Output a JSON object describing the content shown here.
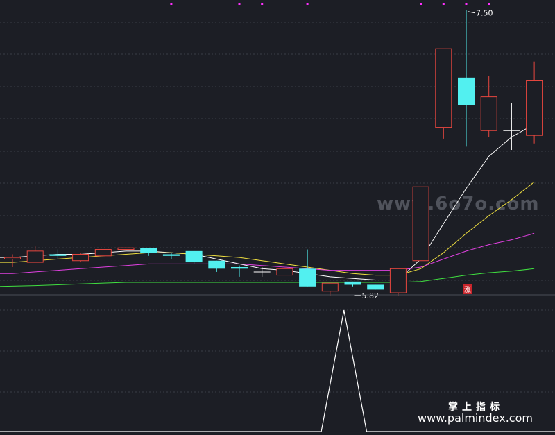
{
  "colors": {
    "background": "#1c1e25",
    "grid": "#3a3d46",
    "up": "#e8473f",
    "down": "#52f0f0",
    "neutral": "#ffffff",
    "ma_short": "#ffffff",
    "ma_mid": "#f0e040",
    "ma_long": "#e040e0",
    "ma_longest": "#40e040",
    "indicator_line": "#ffffff",
    "markers": "#ff30ff",
    "flag_bg": "#c8242a"
  },
  "annotations": {
    "high_label": "7.50",
    "low_label": "5.82",
    "flag_label": "涨"
  },
  "watermark": "www.6o7o.com",
  "brand": {
    "name_cn": "掌上指标",
    "url": "www.palmindex.com"
  },
  "chart_data": [
    {
      "type": "candlestick",
      "title": "",
      "ylim": [
        5.7,
        7.55
      ],
      "price_per_px": 0.00432,
      "top_price": 7.55,
      "candles": [
        {
          "o": 5.98,
          "c": 5.99,
          "h": 6.01,
          "l": 5.93
        },
        {
          "o": 5.96,
          "c": 6.03,
          "h": 6.06,
          "l": 5.96
        },
        {
          "o": 6.01,
          "c": 6.0,
          "h": 6.04,
          "l": 5.98
        },
        {
          "o": 5.97,
          "c": 6.01,
          "h": 6.02,
          "l": 5.96
        },
        {
          "o": 6.0,
          "c": 6.04,
          "h": 6.04,
          "l": 6.0
        },
        {
          "o": 6.04,
          "c": 6.05,
          "h": 6.06,
          "l": 6.03
        },
        {
          "o": 6.05,
          "c": 6.02,
          "h": 6.05,
          "l": 6.0
        },
        {
          "o": 6.01,
          "c": 6.0,
          "h": 6.02,
          "l": 5.98
        },
        {
          "o": 6.03,
          "c": 5.96,
          "h": 6.03,
          "l": 5.95
        },
        {
          "o": 5.97,
          "c": 5.92,
          "h": 5.97,
          "l": 5.9
        },
        {
          "o": 5.93,
          "c": 5.92,
          "h": 5.94,
          "l": 5.87
        },
        {
          "o": 5.9,
          "c": 5.9,
          "h": 5.93,
          "l": 5.87
        },
        {
          "o": 5.88,
          "c": 5.92,
          "h": 5.92,
          "l": 5.88
        },
        {
          "o": 5.92,
          "c": 5.81,
          "h": 6.04,
          "l": 5.81
        },
        {
          "o": 5.78,
          "c": 5.83,
          "h": 5.83,
          "l": 5.75
        },
        {
          "o": 5.84,
          "c": 5.82,
          "h": 5.84,
          "l": 5.81
        },
        {
          "o": 5.82,
          "c": 5.79,
          "h": 5.82,
          "l": 5.79
        },
        {
          "o": 5.77,
          "c": 5.92,
          "h": 5.92,
          "l": 5.75
        },
        {
          "o": 5.97,
          "c": 6.43,
          "h": 6.43,
          "l": 5.97
        },
        {
          "o": 6.8,
          "c": 7.29,
          "h": 7.29,
          "l": 6.73
        },
        {
          "o": 7.11,
          "c": 6.94,
          "h": 7.53,
          "l": 6.68
        },
        {
          "o": 6.78,
          "c": 6.99,
          "h": 7.12,
          "l": 6.74
        },
        {
          "o": 6.78,
          "c": 6.78,
          "h": 6.95,
          "l": 6.66
        },
        {
          "o": 6.75,
          "c": 7.09,
          "h": 7.21,
          "l": 6.7
        }
      ],
      "series": [
        {
          "values": [
            5.99,
            6.0,
            6.01,
            6.01,
            6.02,
            6.03,
            6.03,
            6.02,
            6.01,
            5.98,
            5.95,
            5.92,
            5.91,
            5.89,
            5.87,
            5.86,
            5.85,
            5.85,
            5.98,
            6.2,
            6.42,
            6.62,
            6.74,
            6.82
          ]
        },
        {
          "values": [
            5.96,
            5.97,
            5.98,
            5.99,
            6.0,
            6.01,
            6.02,
            6.02,
            6.01,
            6.0,
            5.99,
            5.97,
            5.95,
            5.93,
            5.91,
            5.89,
            5.88,
            5.88,
            5.92,
            6.02,
            6.14,
            6.25,
            6.35,
            6.46
          ]
        },
        {
          "values": [
            5.89,
            5.9,
            5.91,
            5.92,
            5.93,
            5.94,
            5.95,
            5.95,
            5.95,
            5.95,
            5.95,
            5.94,
            5.93,
            5.92,
            5.91,
            5.91,
            5.91,
            5.91,
            5.93,
            5.98,
            6.03,
            6.07,
            6.1,
            6.14
          ]
        },
        {
          "values": [
            5.81,
            5.815,
            5.82,
            5.825,
            5.83,
            5.835,
            5.835,
            5.835,
            5.835,
            5.835,
            5.835,
            5.835,
            5.835,
            5.835,
            5.835,
            5.835,
            5.835,
            5.835,
            5.84,
            5.86,
            5.88,
            5.895,
            5.905,
            5.92
          ]
        }
      ],
      "high_candle_index": 20,
      "low_candle_index": 15,
      "flag_candle_index": 19,
      "marker_candle_indices": [
        7,
        10,
        11,
        13,
        18,
        19,
        20,
        21
      ]
    },
    {
      "type": "line",
      "title": "",
      "ylim": [
        0,
        1
      ],
      "values": [
        0,
        0,
        0,
        0,
        0,
        0,
        0,
        0,
        0,
        0,
        0,
        0,
        0,
        0,
        1,
        0,
        0,
        0,
        0,
        0,
        0,
        0,
        0,
        0
      ]
    }
  ]
}
